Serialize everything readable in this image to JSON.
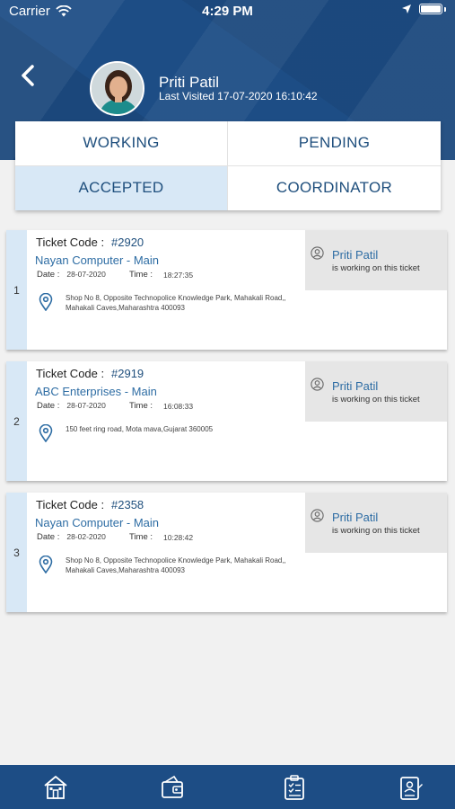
{
  "status_bar": {
    "carrier": "Carrier",
    "time": "4:29 PM"
  },
  "profile": {
    "name": "Priti Patil",
    "last_visited": "Last Visited 17-07-2020 16:10:42"
  },
  "tabs": [
    {
      "label": "WORKING",
      "active": false
    },
    {
      "label": "PENDING",
      "active": false
    },
    {
      "label": "ACCEPTED",
      "active": true
    },
    {
      "label": "COORDINATOR",
      "active": false
    }
  ],
  "tickets": [
    {
      "index": "1",
      "code_label": "Ticket Code :",
      "code": "#2920",
      "company": "Nayan Computer - Main",
      "date_label": "Date :",
      "date": "28-07-2020",
      "time_label": "Time :",
      "time": "18:27:35",
      "address": "Shop No 8, Opposite Technopolice Knowledge Park, Mahakali Road,, Mahakali Caves,Maharashtra 400093",
      "assignee": "Priti Patil",
      "assignee_status": "is working on this ticket"
    },
    {
      "index": "2",
      "code_label": "Ticket Code :",
      "code": "#2919",
      "company": "ABC Enterprises - Main",
      "date_label": "Date :",
      "date": "28-07-2020",
      "time_label": "Time :",
      "time": "16:08:33",
      "address": "150 feet ring road, Mota mava,Gujarat 360005",
      "assignee": "Priti Patil",
      "assignee_status": "is working on this ticket"
    },
    {
      "index": "3",
      "code_label": "Ticket Code :",
      "code": "#2358",
      "company": "Nayan Computer - Main",
      "date_label": "Date :",
      "date": "28-02-2020",
      "time_label": "Time :",
      "time": "10:28:42",
      "address": "Shop No 8, Opposite Technopolice Knowledge Park, Mahakali Road,, Mahakali Caves,Maharashtra 400093",
      "assignee": "Priti Patil",
      "assignee_status": "is working on this ticket"
    }
  ],
  "bottom_nav": [
    {
      "icon": "home-icon"
    },
    {
      "icon": "wallet-icon"
    },
    {
      "icon": "clipboard-icon"
    },
    {
      "icon": "id-badge-icon"
    }
  ],
  "colors": {
    "primary": "#1d4d85",
    "accent_light": "#d8e8f6",
    "link": "#2e6da4"
  }
}
